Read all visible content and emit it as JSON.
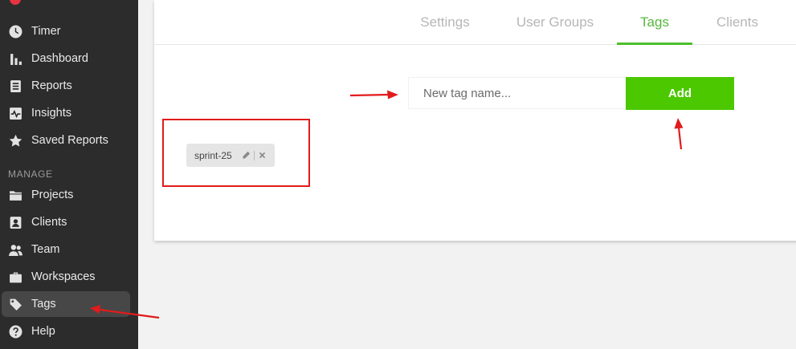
{
  "sidebar": {
    "items": [
      {
        "label": "Timer",
        "icon": "clock-icon"
      },
      {
        "label": "Dashboard",
        "icon": "bar-chart-icon"
      },
      {
        "label": "Reports",
        "icon": "report-icon"
      },
      {
        "label": "Insights",
        "icon": "pulse-icon"
      },
      {
        "label": "Saved Reports",
        "icon": "star-icon"
      }
    ],
    "manage_label": "MANAGE",
    "manage_items": [
      {
        "label": "Projects",
        "icon": "folder-icon"
      },
      {
        "label": "Clients",
        "icon": "contact-icon"
      },
      {
        "label": "Team",
        "icon": "team-icon"
      },
      {
        "label": "Workspaces",
        "icon": "briefcase-icon"
      },
      {
        "label": "Tags",
        "icon": "tag-icon",
        "active": true
      },
      {
        "label": "Help",
        "icon": "help-icon"
      }
    ]
  },
  "tabs": [
    {
      "label": "Settings"
    },
    {
      "label": "User Groups"
    },
    {
      "label": "Tags",
      "active": true
    },
    {
      "label": "Clients"
    }
  ],
  "tag_form": {
    "placeholder": "New tag name...",
    "value": "",
    "add_label": "Add"
  },
  "tags": [
    {
      "name": "sprint-25"
    }
  ],
  "colors": {
    "accent": "#4bc800",
    "active_tab": "#57b83c",
    "annotation": "#e11b1b",
    "sidebar_bg": "#2c2c2c"
  }
}
